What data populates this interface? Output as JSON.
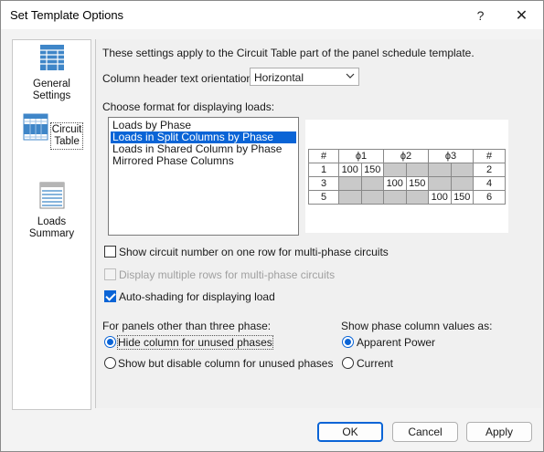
{
  "window": {
    "title": "Set Template Options",
    "help_label": "?",
    "close_label": "✕"
  },
  "nav": [
    {
      "label": "General Settings",
      "line1": "General",
      "line2": "Settings",
      "selected": false
    },
    {
      "label": "Circuit Table",
      "line1": "Circuit",
      "line2": "Table",
      "selected": true
    },
    {
      "label": "Loads Summary",
      "line1": "Loads",
      "line2": "Summary",
      "selected": false
    }
  ],
  "main": {
    "intro": "These settings apply to the Circuit Table part of the panel schedule template.",
    "orientation_label": "Column header text orientation:",
    "orientation_value": "Horizontal",
    "format_label": "Choose format for displaying loads:",
    "format_options": [
      "Loads by Phase",
      "Loads in Split Columns by Phase",
      "Loads in Shared Column by Phase",
      "Mirrored Phase Columns"
    ],
    "selected_format": "Loads in Split Columns by Phase",
    "preview": {
      "headers": [
        "#",
        "ϕ1",
        "ϕ2",
        "ϕ3",
        "#"
      ],
      "rows": [
        {
          "left": "1",
          "cells": [
            "100",
            "150",
            "",
            "",
            "",
            ""
          ],
          "right": "2"
        },
        {
          "left": "3",
          "cells": [
            "",
            "",
            "100",
            "150",
            "",
            ""
          ],
          "right": "4"
        },
        {
          "left": "5",
          "cells": [
            "",
            "",
            "",
            "",
            "100",
            "150"
          ],
          "right": "6"
        }
      ]
    },
    "show_circuit_number": {
      "label": "Show circuit number on one row for multi-phase circuits",
      "checked": false
    },
    "display_multiple_rows": {
      "label": "Display multiple rows for multi-phase circuits",
      "checked": false,
      "disabled": true
    },
    "auto_shading": {
      "label": "Auto-shading for displaying load",
      "checked": true
    },
    "other_phase_label": "For panels other than three phase:",
    "other_phase_options": [
      {
        "label": "Hide column for unused phases",
        "selected": true
      },
      {
        "label": "Show but disable column for unused phases",
        "selected": false
      }
    ],
    "phase_values_label": "Show phase column values as:",
    "phase_values_options": [
      {
        "label": "Apparent Power",
        "selected": true
      },
      {
        "label": "Current",
        "selected": false
      }
    ]
  },
  "buttons": {
    "ok": "OK",
    "cancel": "Cancel",
    "apply": "Apply"
  },
  "colors": {
    "accent": "#0a64d6",
    "shade": "#c9c9c9",
    "icon_blue": "#3f86c8"
  }
}
